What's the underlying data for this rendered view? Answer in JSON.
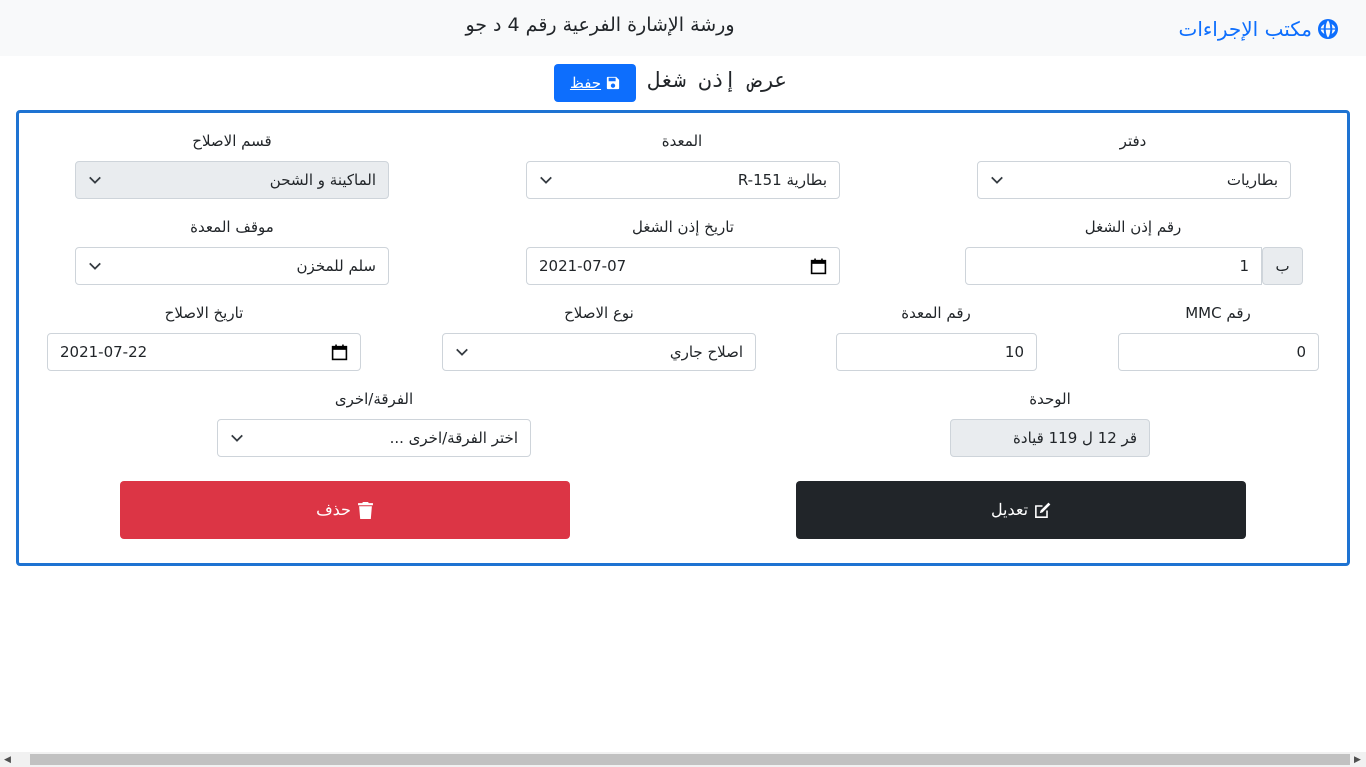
{
  "navbar": {
    "brand": "مكتب الإجراءات",
    "title": "ورشة الإشارة الفرعية رقم 4 د جو"
  },
  "header": {
    "title": "عرض إذن شغل",
    "save_label": "حفظ"
  },
  "form": {
    "daftar": {
      "label": "دفتر",
      "value": "بطاريات"
    },
    "equipment": {
      "label": "المعدة",
      "value": "بطارية R-151"
    },
    "repair_section": {
      "label": "قسم الاصلاح",
      "value": "الماكينة و الشحن"
    },
    "order_number": {
      "label": "رقم إذن الشغل",
      "prefix": "ب",
      "value": "1"
    },
    "order_date": {
      "label": "تاريخ إذن الشغل",
      "value": "2021-07-07"
    },
    "equipment_status": {
      "label": "موقف المعدة",
      "value": "سلم للمخزن"
    },
    "mmc_number": {
      "label": "رقم MMC",
      "value": "0"
    },
    "equipment_number": {
      "label": "رقم المعدة",
      "value": "10"
    },
    "repair_type": {
      "label": "نوع الاصلاح",
      "value": "اصلاح جاري"
    },
    "repair_date": {
      "label": "تاريخ الاصلاح",
      "value": "2021-07-22"
    },
    "unit": {
      "label": "الوحدة",
      "value": "قر 12 ل 119 قيادة"
    },
    "division": {
      "label": "الفرقة/اخرى",
      "value": "اختر الفرقة/اخرى ..."
    }
  },
  "actions": {
    "edit_label": "تعديل",
    "delete_label": "حذف"
  },
  "colors": {
    "primary": "#0d6efd",
    "danger": "#dc3545",
    "dark": "#212529",
    "panel_border": "#1e73d2"
  }
}
